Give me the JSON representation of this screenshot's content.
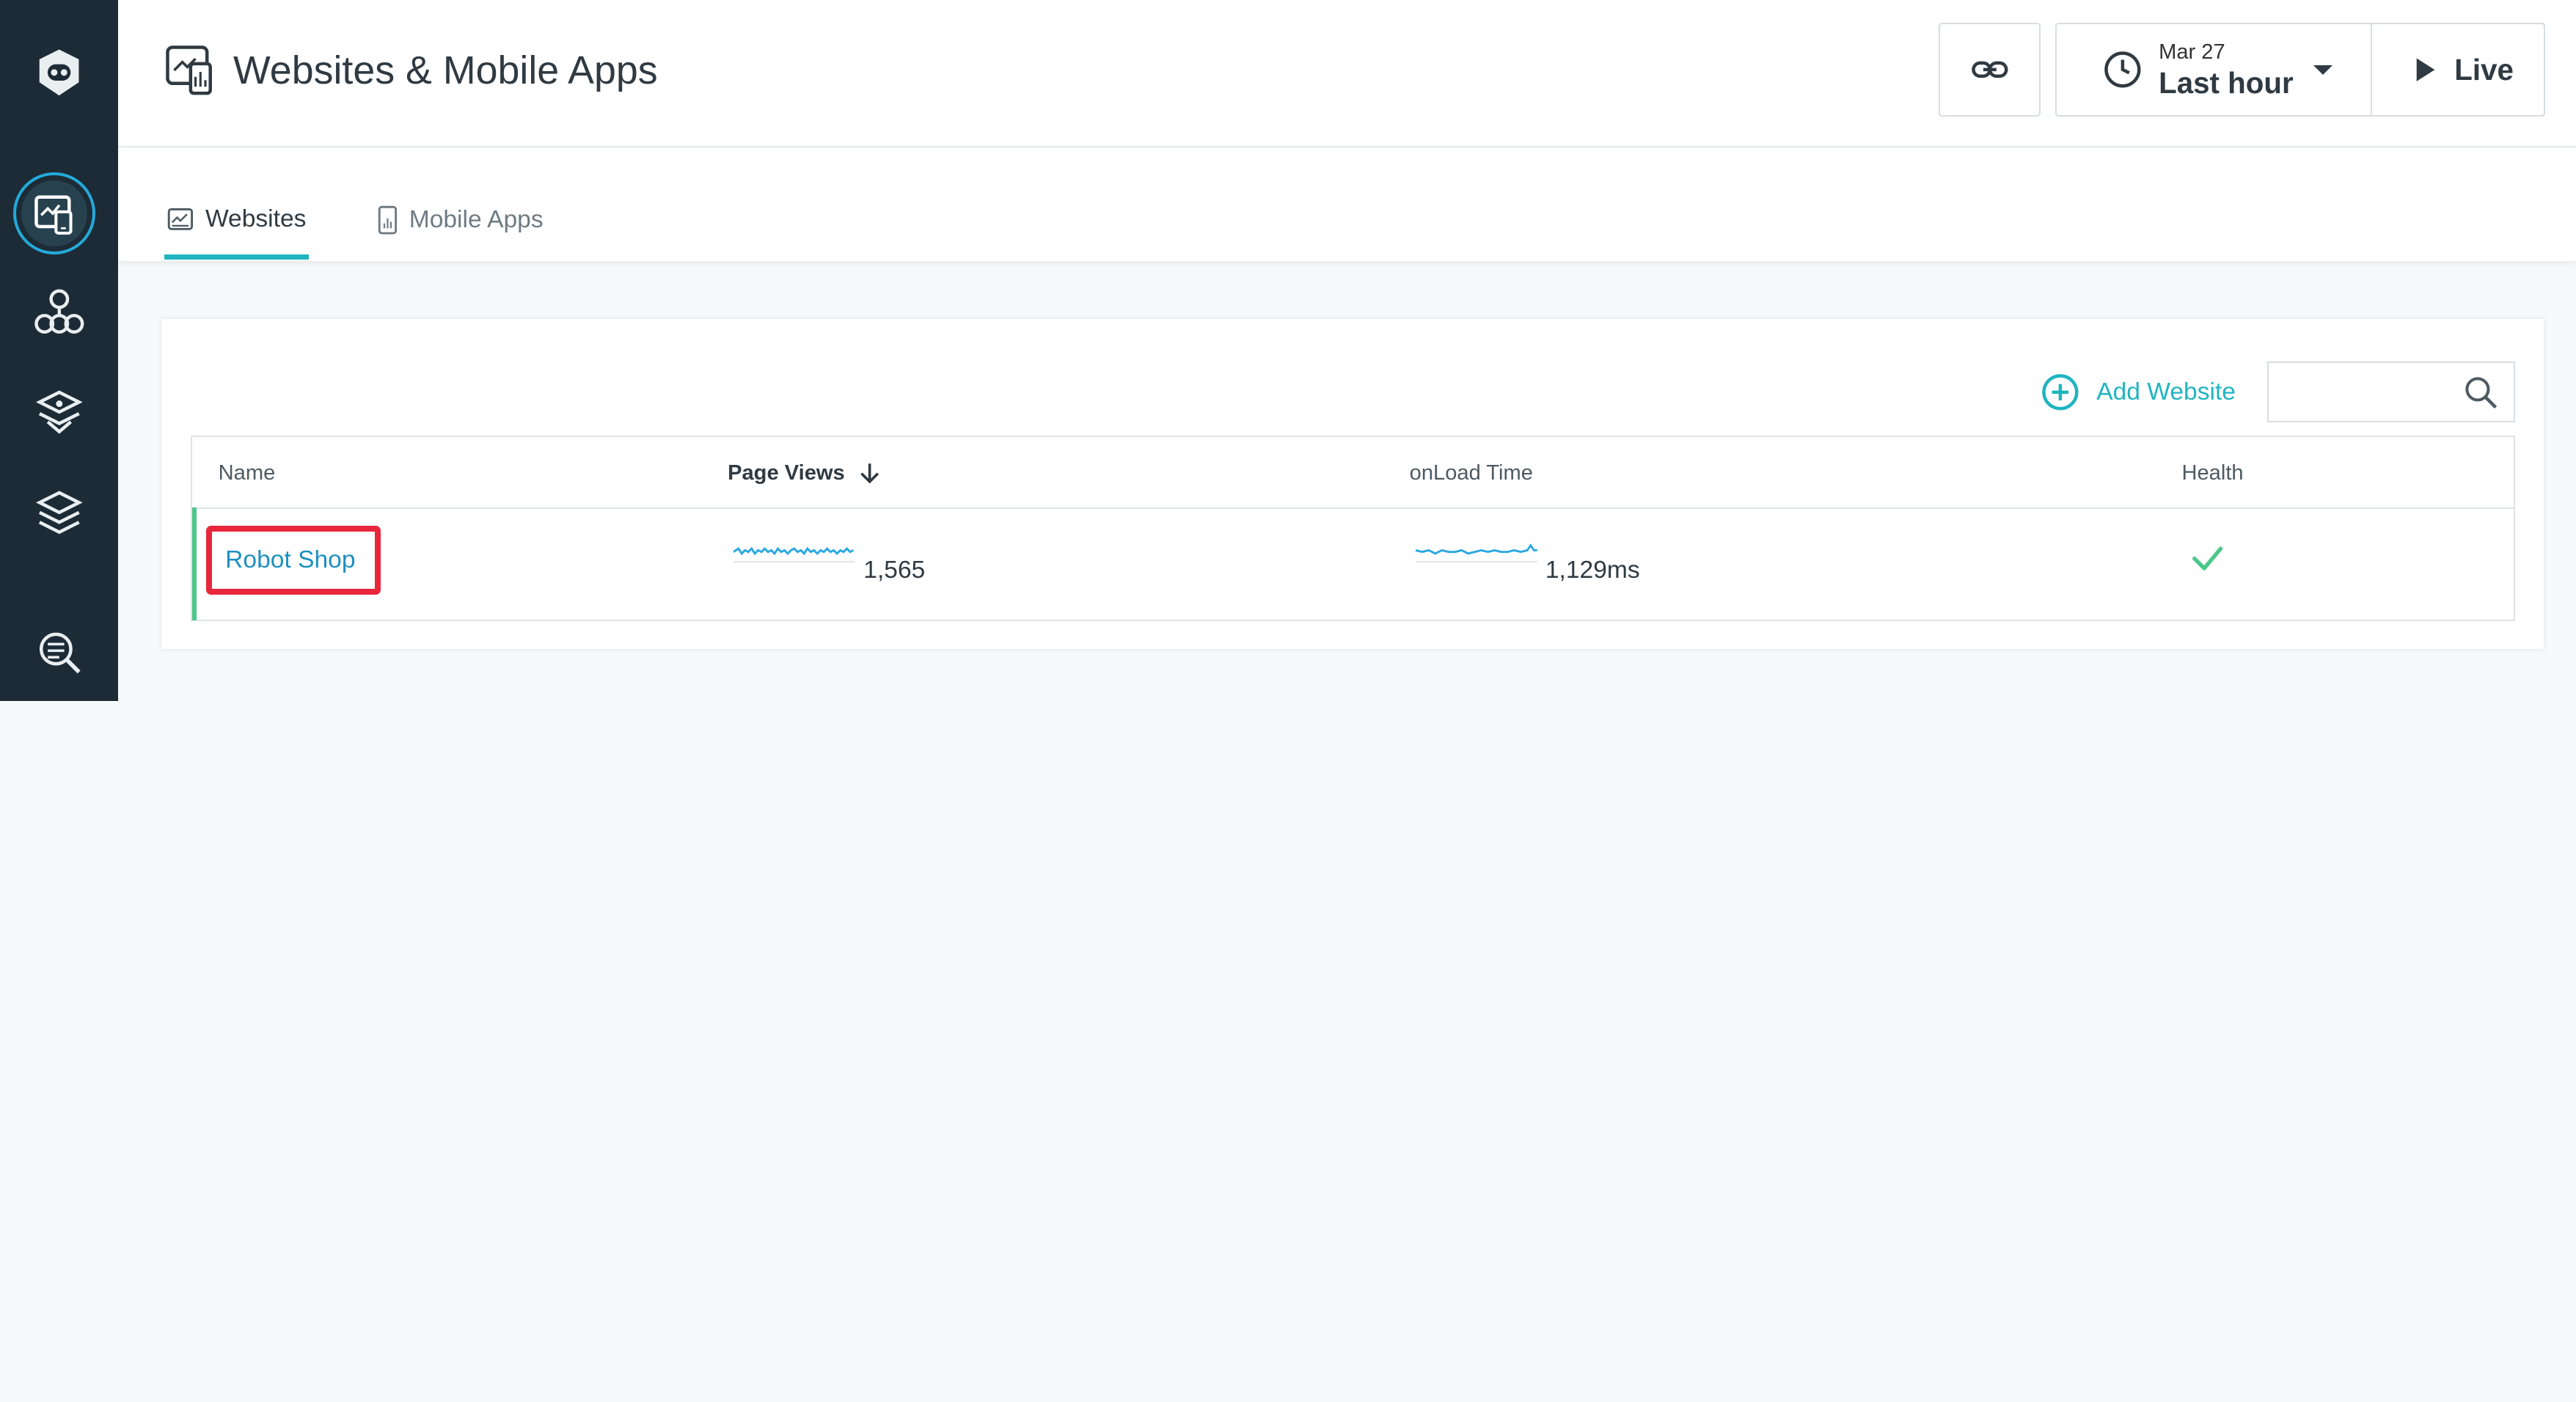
{
  "header": {
    "title": "Websites & Mobile Apps",
    "time_date": "Mar 27",
    "time_range": "Last hour",
    "live_label": "Live"
  },
  "tabs": [
    {
      "label": "Websites",
      "active": true
    },
    {
      "label": "Mobile Apps",
      "active": false
    }
  ],
  "panel": {
    "add_website_label": "Add Website",
    "search_placeholder": ""
  },
  "table": {
    "columns": [
      "Name",
      "Page Views",
      "onLoad Time",
      "Health"
    ],
    "sort_column": "Page Views",
    "rows": [
      {
        "name": "Robot Shop",
        "page_views": "1,565",
        "onload_time": "1,129ms",
        "health": "ok"
      }
    ]
  },
  "colors": {
    "sidebar_bg": "#1c2b35",
    "accent_teal": "#1fb5c0",
    "link_blue": "#1e90c0",
    "health_green": "#4cc78a",
    "highlight_red": "#e8263c"
  },
  "icons": {
    "sidebar": [
      "robot-logo-icon",
      "websites-icon",
      "infrastructure-icon",
      "applications-icon",
      "platforms-icon",
      "analyze-icon"
    ],
    "header": [
      "websites-apps-icon",
      "link-icon",
      "clock-icon",
      "play-icon"
    ]
  }
}
